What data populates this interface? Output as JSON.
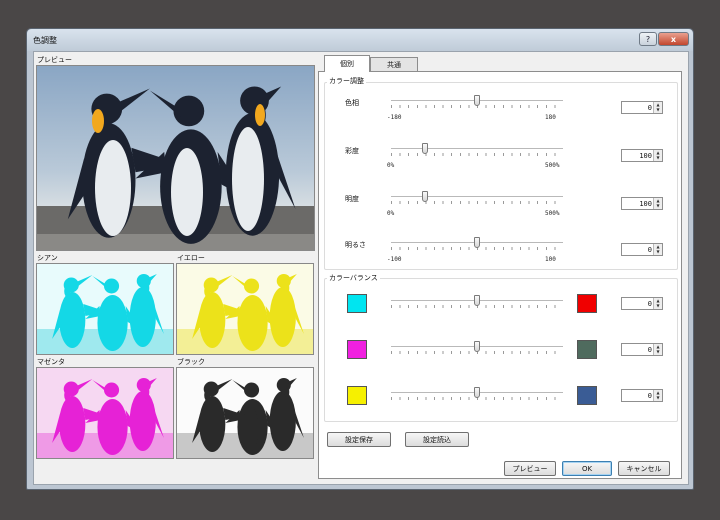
{
  "window": {
    "title": "色調整",
    "help_label": "?",
    "close_label": "x"
  },
  "preview": {
    "label": "プレビュー"
  },
  "channels": [
    {
      "label": "シアン",
      "color": "#00e5f0"
    },
    {
      "label": "イエロー",
      "color": "#f6f000"
    },
    {
      "label": "マゼンタ",
      "color": "#f020e0"
    },
    {
      "label": "ブラック",
      "color": "#222222"
    }
  ],
  "tabs": [
    {
      "label": "個別"
    },
    {
      "label": "共通"
    }
  ],
  "color_adjust": {
    "title": "カラー調整",
    "rows": [
      {
        "label": "色相",
        "min_label": "-180",
        "max_label": "180",
        "value": "0",
        "fraction": 0.5
      },
      {
        "label": "彩度",
        "min_label": "0%",
        "max_label": "500%",
        "value": "100",
        "fraction": 0.2
      },
      {
        "label": "明度",
        "min_label": "0%",
        "max_label": "500%",
        "value": "100",
        "fraction": 0.2
      },
      {
        "label": "明るさ",
        "min_label": "-100",
        "max_label": "100",
        "value": "0",
        "fraction": 0.5
      }
    ]
  },
  "color_balance": {
    "title": "カラーバランス",
    "rows": [
      {
        "left_color": "#00e5f0",
        "right_color": "#f00000",
        "value": "0",
        "fraction": 0.5
      },
      {
        "left_color": "#f020e0",
        "right_color": "#4f6b5e",
        "value": "0",
        "fraction": 0.5
      },
      {
        "left_color": "#f6f000",
        "right_color": "#3a5c95",
        "value": "0",
        "fraction": 0.5
      }
    ]
  },
  "buttons": {
    "save_settings": "設定保存",
    "load_settings": "設定読込",
    "preview": "プレビュー",
    "ok": "OK",
    "cancel": "キャンセル"
  }
}
